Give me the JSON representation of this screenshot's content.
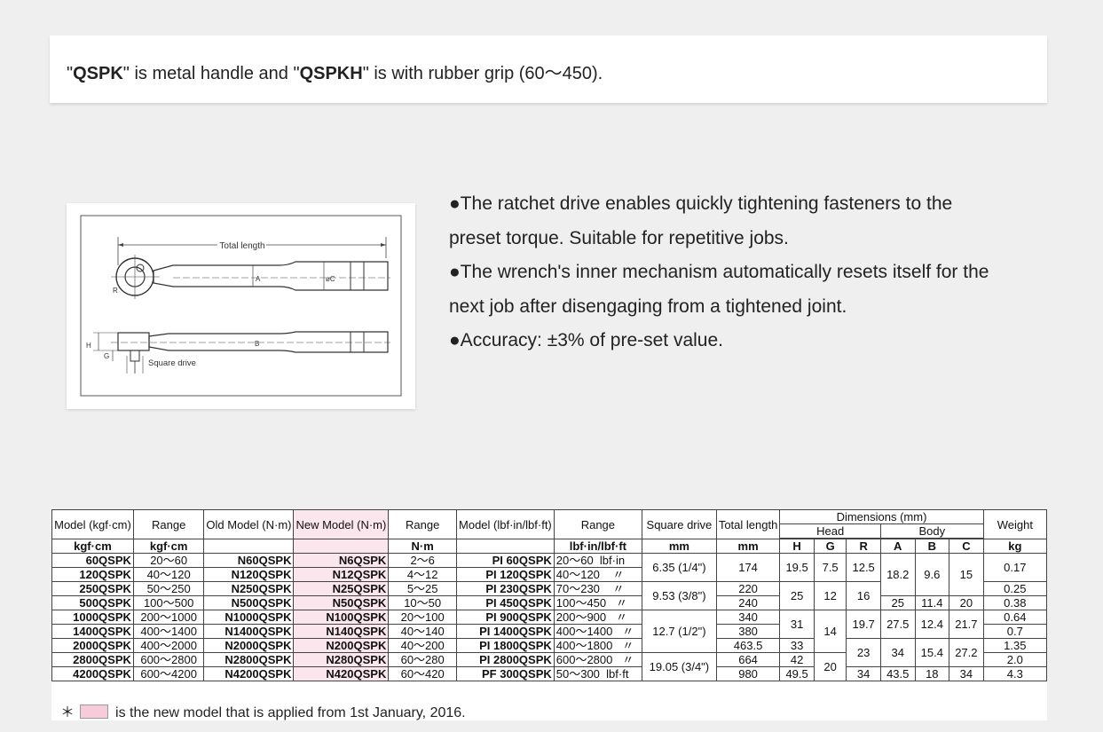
{
  "note": {
    "q1": "\"",
    "model1": "QSPK",
    "mid": "\" is metal handle and \"",
    "model2": "QSPKH",
    "tail": "\" is with rubber grip (60〜450)."
  },
  "figure": {
    "total_length": "Total length",
    "label_a": "A",
    "label_c": "øC",
    "label_r": "R",
    "label_h": "H",
    "label_g": "G",
    "label_b": "B",
    "square_drive": "Square drive"
  },
  "features": [
    "●The ratchet drive enables quickly tightening fasteners to the",
    "preset torque. Suitable for repetitive jobs.",
    "●The wrench's inner mechanism automatically resets itself for the",
    "next job after disengaging from a tightened joint.",
    "●Accuracy: ±3% of pre-set value."
  ],
  "table": {
    "headers": {
      "model_kgf": "Model (kgf·cm)",
      "range": "Range",
      "old_model": "Old Model (N·m)",
      "new_model": "New Model (N·m)",
      "range2": "Range",
      "model_lbf": "Model (lbf·in/lbf·ft)",
      "range3": "Range",
      "square_drive": "Square drive",
      "total_length": "Total length",
      "dimensions": "Dimensions (mm)",
      "head": "Head",
      "body": "Body",
      "weight": "Weight"
    },
    "units": [
      "kgf·cm",
      "N·m",
      "lbf·in/lbf·ft",
      "mm",
      "mm",
      "H",
      "G",
      "R",
      "A",
      "B",
      "C",
      "kg"
    ],
    "rows": [
      {
        "model": "60QSPK",
        "range": "20～60",
        "old": "N60QSPK",
        "new": "N6QSPK",
        "range_n": "2～6",
        "lbf_model": "PI 60QSPK",
        "range_lbf": "20～60",
        "unit": "lbf·in",
        "sq": "6.35 (1/4\")",
        "tl": "174",
        "h": "19.5",
        "g": "7.5",
        "r": "12.5",
        "a": "18.2",
        "b": "9.6",
        "c": "15",
        "w": "0.17"
      },
      {
        "model": "120QSPK",
        "range": "40～120",
        "old": "N120QSPK",
        "new": "N12QSPK",
        "range_n": "4～12",
        "lbf_model": "PI 120QSPK",
        "range_lbf": "40～120",
        "unit": "〃"
      },
      {
        "model": "250QSPK",
        "range": "50～250",
        "old": "N250QSPK",
        "new": "N25QSPK",
        "range_n": "5～25",
        "lbf_model": "PI 230QSPK",
        "range_lbf": "70～230",
        "unit": "〃",
        "sq": "9.53 (3/8\")",
        "tl": "220",
        "h": "25",
        "g": "12",
        "r": "16",
        "w": "0.25"
      },
      {
        "model": "500QSPK",
        "range": "100～500",
        "old": "N500QSPK",
        "new": "N50QSPK",
        "range_n": "10～50",
        "lbf_model": "PI 450QSPK",
        "range_lbf": "100～450",
        "unit": "〃",
        "tl": "240",
        "a": "25",
        "b": "11.4",
        "c": "20",
        "w": "0.38"
      },
      {
        "model": "1000QSPK",
        "range": "200～1000",
        "old": "N1000QSPK",
        "new": "N100QSPK",
        "range_n": "20～100",
        "lbf_model": "PI 900QSPK",
        "range_lbf": "200～900",
        "unit": "〃",
        "sq": "12.7 (1/2\")",
        "tl": "340",
        "h": "31",
        "g": "14",
        "r": "19.7",
        "a": "27.5",
        "b": "12.4",
        "c": "21.7",
        "w": "0.64"
      },
      {
        "model": "1400QSPK",
        "range": "400～1400",
        "old": "N1400QSPK",
        "new": "N140QSPK",
        "range_n": "40～140",
        "lbf_model": "PI 1400QSPK",
        "range_lbf": "400～1400",
        "unit": "〃",
        "tl": "380",
        "w": "0.7"
      },
      {
        "model": "2000QSPK",
        "range": "400～2000",
        "old": "N2000QSPK",
        "new": "N200QSPK",
        "range_n": "40～200",
        "lbf_model": "PI 1800QSPK",
        "range_lbf": "400～1800",
        "unit": "〃",
        "tl": "463.5",
        "h": "33",
        "r": "23",
        "a": "34",
        "b": "15.4",
        "c": "27.2",
        "w": "1.35"
      },
      {
        "model": "2800QSPK",
        "range": "600～2800",
        "old": "N2800QSPK",
        "new": "N280QSPK",
        "range_n": "60～280",
        "lbf_model": "PI 2800QSPK",
        "range_lbf": "600～2800",
        "unit": "〃",
        "sq": "19.05 (3/4\")",
        "tl": "664",
        "h": "42",
        "g": "20",
        "w": "2.0"
      },
      {
        "model": "4200QSPK",
        "range": "600～4200",
        "old": "N4200QSPK",
        "new": "N420QSPK",
        "range_n": "60～420",
        "lbf_model": "PF 300QSPK",
        "range_lbf": "50～300",
        "unit": "lbf·ft",
        "tl": "980",
        "h": "49.5",
        "r": "34",
        "a": "43.5",
        "b": "18",
        "c": "34",
        "w": "4.3"
      }
    ],
    "footnote_star": "＊",
    "footnote": "is the new model that is applied from 1st January, 2016."
  },
  "colors": {
    "new_model_bg": "#fbe6ee",
    "swatch": "#f7cbd9",
    "page_bg": "#efefef"
  }
}
